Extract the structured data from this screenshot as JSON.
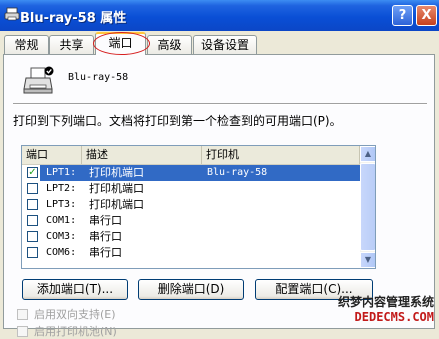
{
  "window": {
    "title": "Blu-ray-58 属性",
    "help_btn": "?",
    "close_btn": "X"
  },
  "tabs": [
    {
      "label": "常规",
      "active": false
    },
    {
      "label": "共享",
      "active": false
    },
    {
      "label": "端口",
      "active": true
    },
    {
      "label": "高级",
      "active": false
    },
    {
      "label": "设备设置",
      "active": false
    }
  ],
  "printer": {
    "name": "Blu-ray-58",
    "icon": "printer-icon"
  },
  "description": "打印到下列端口。文档将打印到第一个检查到的可用端口(P)。",
  "ports_list": {
    "headers": [
      "端口",
      "描述",
      "打印机"
    ],
    "rows": [
      {
        "port": "LPT1:",
        "desc": "打印机端口",
        "printer": "Blu-ray-58",
        "checked": true,
        "selected": true
      },
      {
        "port": "LPT2:",
        "desc": "打印机端口",
        "printer": "",
        "checked": false,
        "selected": false
      },
      {
        "port": "LPT3:",
        "desc": "打印机端口",
        "printer": "",
        "checked": false,
        "selected": false
      },
      {
        "port": "COM1:",
        "desc": "串行口",
        "printer": "",
        "checked": false,
        "selected": false
      },
      {
        "port": "COM3:",
        "desc": "串行口",
        "printer": "",
        "checked": false,
        "selected": false
      },
      {
        "port": "COM6:",
        "desc": "串行口",
        "printer": "",
        "checked": false,
        "selected": false
      }
    ]
  },
  "buttons": {
    "add_port": "添加端口(T)...",
    "delete_port": "删除端口(D)",
    "configure_port": "配置端口(C)..."
  },
  "options": {
    "bidirectional": "启用双向支持(E)",
    "pooling": "启用打印机池(N)"
  },
  "watermark": {
    "line1": "织梦内容管理系统",
    "line2": "DEDECMS.COM"
  },
  "colors": {
    "titlebar": "#0a4fd6",
    "selection": "#316ac5",
    "tab_highlight_circle": "#d62020",
    "watermark_red": "#c21a1a"
  }
}
